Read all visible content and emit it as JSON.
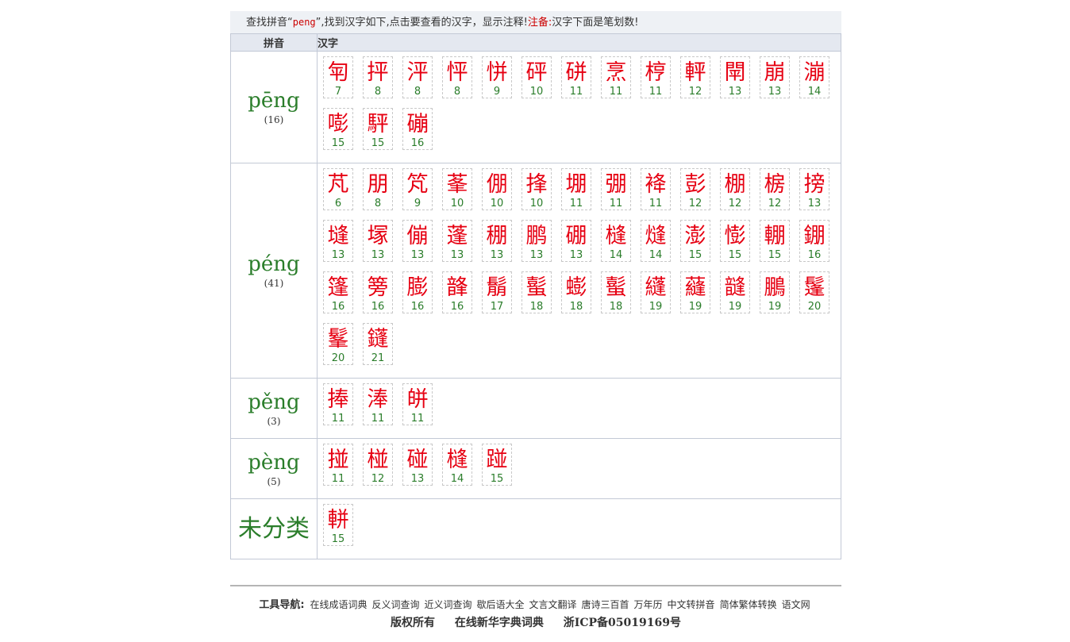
{
  "header": {
    "prefix": "查找拼音“",
    "keyword": "peng",
    "middle": "”,找到汉字如下,点击要查看的汉字，显示注释!",
    "note_label": "注备:",
    "note_text": "汉字下面是笔划数!"
  },
  "table": {
    "col_pinyin": "拼音",
    "col_hanzi": "汉字",
    "rows": [
      {
        "pinyin": "pēng",
        "count": "(16)",
        "chars": [
          {
            "c": "匉",
            "s": "7"
          },
          {
            "c": "抨",
            "s": "8"
          },
          {
            "c": "泙",
            "s": "8"
          },
          {
            "c": "怦",
            "s": "8"
          },
          {
            "c": "恲",
            "s": "9"
          },
          {
            "c": "砰",
            "s": "10"
          },
          {
            "c": "硑",
            "s": "11"
          },
          {
            "c": "烹",
            "s": "11"
          },
          {
            "c": "梈",
            "s": "11"
          },
          {
            "c": "軯",
            "s": "12"
          },
          {
            "c": "閛",
            "s": "13"
          },
          {
            "c": "崩",
            "s": "13"
          },
          {
            "c": "漰",
            "s": "14"
          },
          {
            "c": "嘭",
            "s": "15"
          },
          {
            "c": "駍",
            "s": "15"
          },
          {
            "c": "磞",
            "s": "16"
          }
        ]
      },
      {
        "pinyin": "péng",
        "count": "(41)",
        "chars": [
          {
            "c": "芃",
            "s": "6"
          },
          {
            "c": "朋",
            "s": "8"
          },
          {
            "c": "竼",
            "s": "9"
          },
          {
            "c": "莑",
            "s": "10"
          },
          {
            "c": "倗",
            "s": "10"
          },
          {
            "c": "捀",
            "s": "10"
          },
          {
            "c": "堋",
            "s": "11"
          },
          {
            "c": "弸",
            "s": "11"
          },
          {
            "c": "袶",
            "s": "11"
          },
          {
            "c": "彭",
            "s": "12"
          },
          {
            "c": "棚",
            "s": "12"
          },
          {
            "c": "椖",
            "s": "12"
          },
          {
            "c": "搒",
            "s": "13"
          },
          {
            "c": "塳",
            "s": "13"
          },
          {
            "c": "塜",
            "s": "13"
          },
          {
            "c": "傰",
            "s": "13"
          },
          {
            "c": "蓬",
            "s": "13"
          },
          {
            "c": "稝",
            "s": "13"
          },
          {
            "c": "鹏",
            "s": "13"
          },
          {
            "c": "硼",
            "s": "13"
          },
          {
            "c": "槰",
            "s": "14"
          },
          {
            "c": "熢",
            "s": "14"
          },
          {
            "c": "澎",
            "s": "15"
          },
          {
            "c": "憉",
            "s": "15"
          },
          {
            "c": "輣",
            "s": "15"
          },
          {
            "c": "錋",
            "s": "16"
          },
          {
            "c": "篷",
            "s": "16"
          },
          {
            "c": "篣",
            "s": "16"
          },
          {
            "c": "膨",
            "s": "16"
          },
          {
            "c": "韸",
            "s": "16"
          },
          {
            "c": "鬅",
            "s": "17"
          },
          {
            "c": "蟚",
            "s": "18"
          },
          {
            "c": "蟛",
            "s": "18"
          },
          {
            "c": "蟚",
            "s": "18"
          },
          {
            "c": "纄",
            "s": "19"
          },
          {
            "c": "蘕",
            "s": "19"
          },
          {
            "c": "韼",
            "s": "19"
          },
          {
            "c": "鵬",
            "s": "19"
          },
          {
            "c": "鬔",
            "s": "20"
          },
          {
            "c": "髼",
            "s": "20"
          },
          {
            "c": "鑝",
            "s": "21"
          }
        ]
      },
      {
        "pinyin": "pěng",
        "count": "(3)",
        "chars": [
          {
            "c": "捧",
            "s": "11"
          },
          {
            "c": "淎",
            "s": "11"
          },
          {
            "c": "皏",
            "s": "11"
          }
        ]
      },
      {
        "pinyin": "pèng",
        "count": "(5)",
        "chars": [
          {
            "c": "掽",
            "s": "11"
          },
          {
            "c": "椪",
            "s": "12"
          },
          {
            "c": "碰",
            "s": "13"
          },
          {
            "c": "槰",
            "s": "14"
          },
          {
            "c": "踫",
            "s": "15"
          }
        ]
      },
      {
        "pinyin": "未分类",
        "count": "",
        "wide": true,
        "chars": [
          {
            "c": "軿",
            "s": "15"
          }
        ]
      }
    ]
  },
  "footer": {
    "nav_label": "工具导航:",
    "links": [
      "在线成语词典",
      "反义词查询",
      "近义词查询",
      "歇后语大全",
      "文言文翻译",
      "唐诗三百首",
      "万年历",
      "中文转拼音",
      "简体繁体转换",
      "语文网"
    ],
    "copyright": [
      "版权所有",
      "在线新华字典词典",
      "浙ICP备05019169号"
    ]
  }
}
